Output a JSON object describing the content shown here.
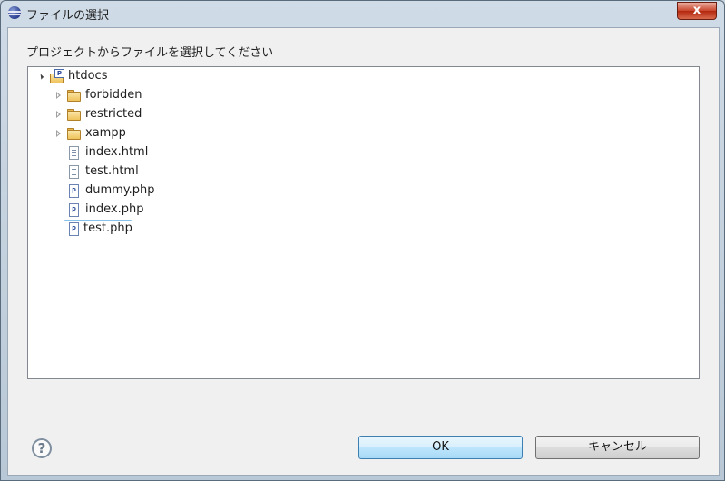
{
  "window": {
    "title": "ファイルの選択",
    "close_label": "x"
  },
  "dialog": {
    "prompt": "プロジェクトからファイルを選択してください"
  },
  "tree": {
    "root": {
      "label": "htdocs",
      "expanded": true,
      "icon": "project-folder-icon"
    },
    "children": [
      {
        "label": "forbidden",
        "type": "folder",
        "expanded": false
      },
      {
        "label": "restricted",
        "type": "folder",
        "expanded": false
      },
      {
        "label": "xampp",
        "type": "folder",
        "expanded": false
      },
      {
        "label": "index.html",
        "type": "html-file"
      },
      {
        "label": "test.html",
        "type": "html-file"
      },
      {
        "label": "dummy.php",
        "type": "php-file"
      },
      {
        "label": "index.php",
        "type": "php-file"
      },
      {
        "label": "test.php",
        "type": "php-file",
        "selected": true
      }
    ]
  },
  "buttons": {
    "ok": "OK",
    "cancel": "キャンセル",
    "help_glyph": "?"
  },
  "colors": {
    "selection_border": "#86c2ec",
    "ok_border": "#3c7fb1",
    "close_red": "#c8452c"
  }
}
